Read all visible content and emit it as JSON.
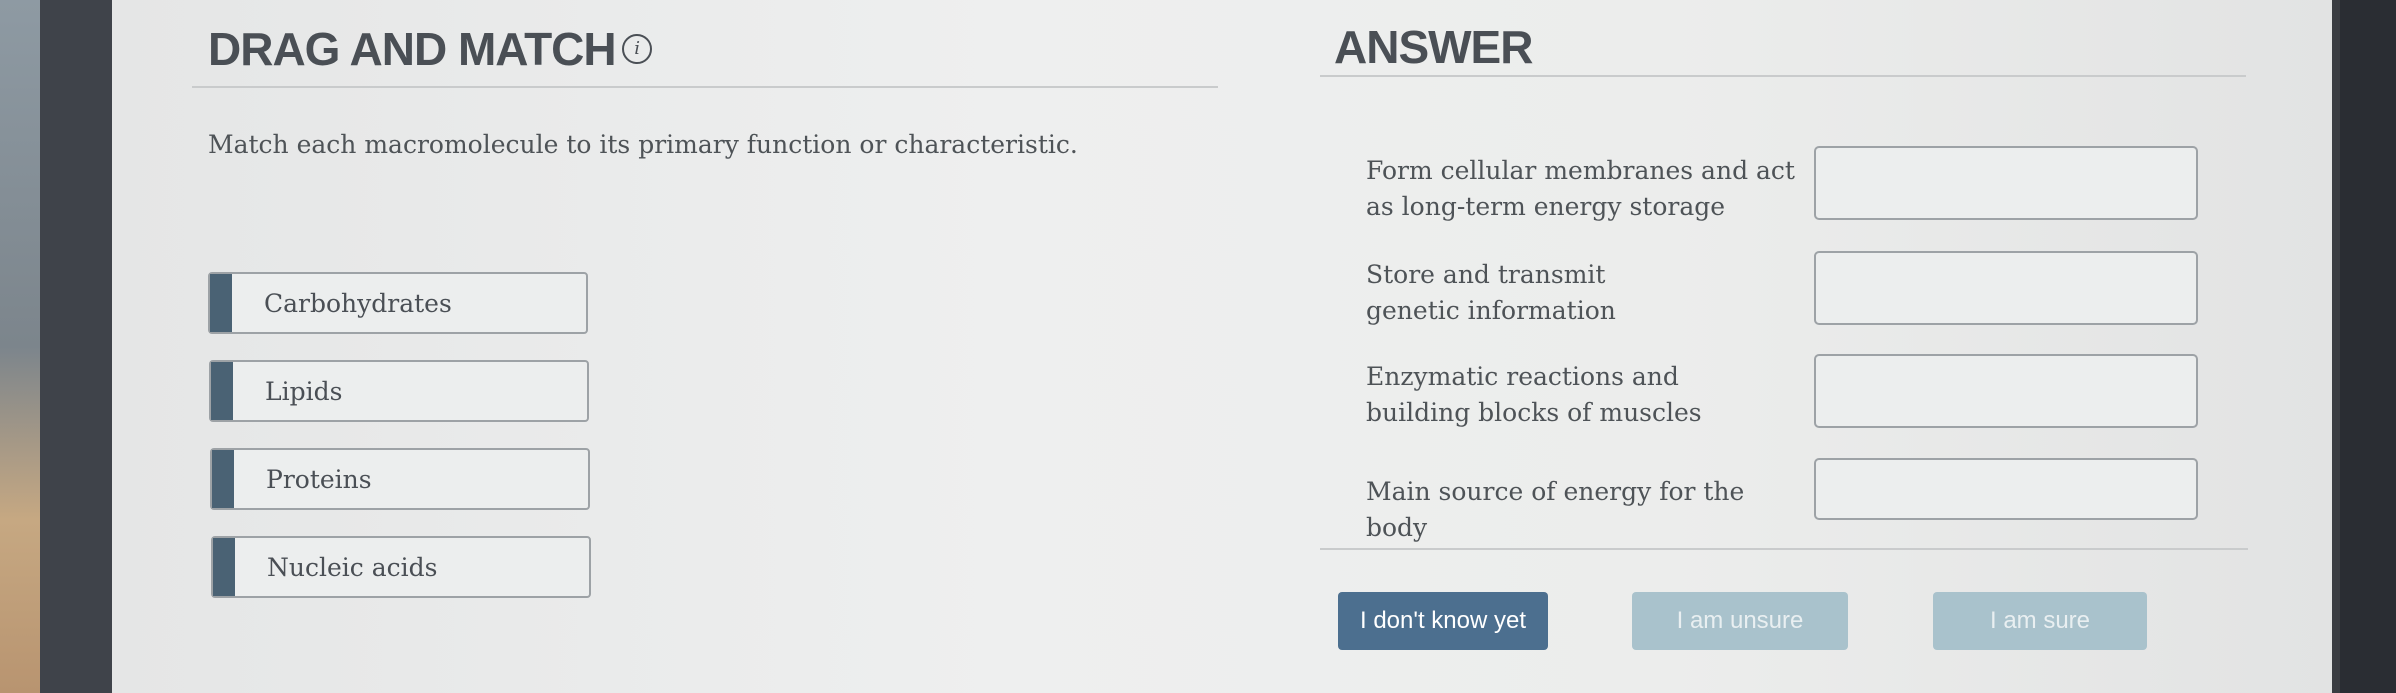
{
  "left_panel": {
    "title": "DRAG AND MATCH",
    "info_icon_glyph": "i",
    "instruction": "Match each macromolecule to its primary function or characteristic.",
    "choices": [
      "Carbohydrates",
      "Lipids",
      "Proteins",
      "Nucleic acids"
    ]
  },
  "right_panel": {
    "title": "ANSWER",
    "prompts": [
      "Form cellular membranes and act as long-term energy storage",
      "Store and transmit genetic information",
      "Enzymatic reactions and building blocks of muscles",
      "Main source of energy for the body"
    ]
  },
  "buttons": {
    "dont_know": "I don't know yet",
    "unsure": "I am unsure",
    "sure": "I am sure"
  },
  "colors": {
    "accent_bar": "#4a6274",
    "primary_button": "#4c6f8f",
    "muted_button": "#a9c2cc"
  }
}
